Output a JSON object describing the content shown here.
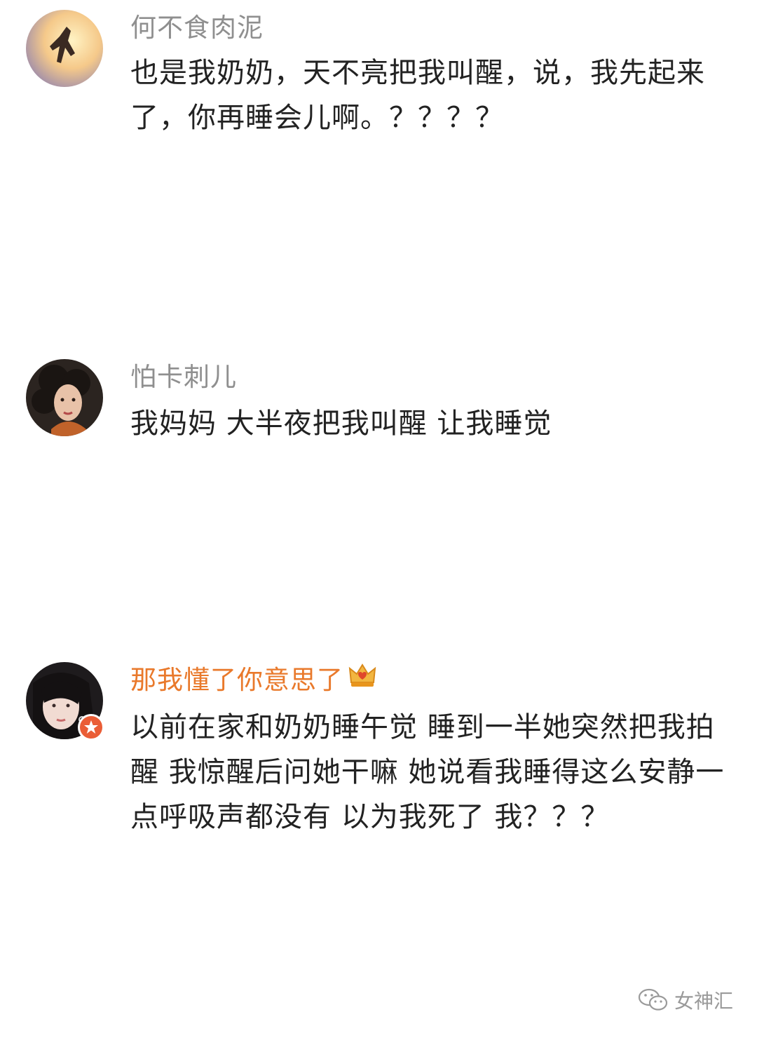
{
  "comments": [
    {
      "username": "何不食肉泥",
      "text": "也是我奶奶，天不亮把我叫醒，说，我先起来了，你再睡会儿啊。？？？？",
      "avatar": "avatar-photo-figure"
    },
    {
      "username": "怕卡刺儿",
      "text": "我妈妈 大半夜把我叫醒 让我睡觉",
      "avatar": "avatar-photo-curly-hair-woman"
    },
    {
      "username": "那我懂了你意思了",
      "text": "以前在家和奶奶睡午觉 睡到一半她突然把我拍醒 我惊醒后问她干嘛 她说看我睡得这么安静一点呼吸声都没有 以为我死了 我？？？",
      "avatar": "avatar-photo-woman",
      "username_color": "#e9792b",
      "badges": [
        "crown-icon",
        "verified-star-icon"
      ]
    }
  ],
  "watermark": {
    "icon": "wechat-icon",
    "label": "女神汇"
  }
}
